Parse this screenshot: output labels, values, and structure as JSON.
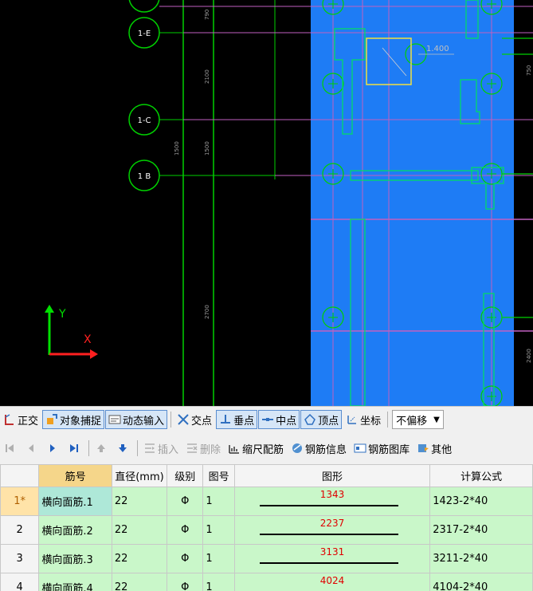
{
  "cad": {
    "grid_labels": [
      "1-E",
      "1-C",
      "1 B"
    ],
    "dimensions": [
      "790",
      "2100",
      "1500",
      "1500",
      "2700",
      "750",
      "2400"
    ],
    "elevation_label": "1.400",
    "axis_x": "X",
    "axis_y": "Y",
    "colors": {
      "background": "#000000",
      "slab": "#1e7cf5",
      "axis_line": "#00d000",
      "grid_line": "#c060c0"
    }
  },
  "snap_toolbar": {
    "ortho": "正交",
    "object_snap": "对象捕捉",
    "dynamic_input": "动态输入",
    "intersection": "交点",
    "perpendicular": "垂点",
    "midpoint": "中点",
    "vertex": "顶点",
    "coordinate": "坐标",
    "offset_value": "不偏移"
  },
  "rebar_toolbar": {
    "insert": "插入",
    "delete": "删除",
    "scale_rebar": "缩尺配筋",
    "rebar_info": "钢筋信息",
    "rebar_library": "钢筋图库",
    "other": "其他"
  },
  "grid": {
    "columns": [
      "筋号",
      "直径(mm)",
      "级别",
      "图号",
      "图形",
      "计算公式"
    ],
    "rows": [
      {
        "num": "1*",
        "name": "横向面筋.1",
        "diameter": "22",
        "grade": "Φ",
        "fig": "1",
        "length": "1343",
        "formula": "1423-2*40"
      },
      {
        "num": "2",
        "name": "横向面筋.2",
        "diameter": "22",
        "grade": "Φ",
        "fig": "1",
        "length": "2237",
        "formula": "2317-2*40"
      },
      {
        "num": "3",
        "name": "横向面筋.3",
        "diameter": "22",
        "grade": "Φ",
        "fig": "1",
        "length": "3131",
        "formula": "3211-2*40"
      },
      {
        "num": "4",
        "name": "横向面筋.4",
        "diameter": "22",
        "grade": "Φ",
        "fig": "1",
        "length": "4024",
        "formula": "4104-2*40"
      }
    ]
  }
}
